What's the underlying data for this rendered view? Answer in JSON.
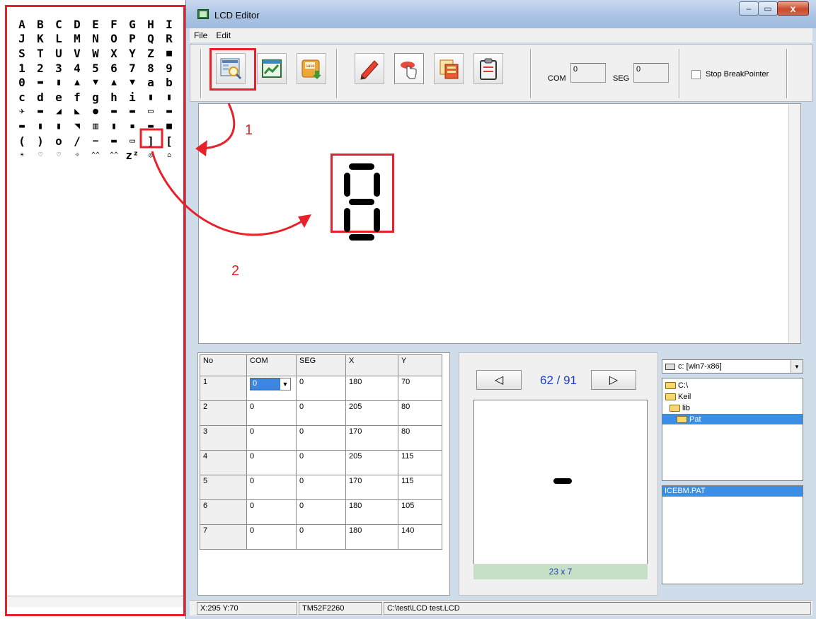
{
  "palette": {
    "glyphs": [
      "A",
      "B",
      "C",
      "D",
      "E",
      "F",
      "G",
      "H",
      "I",
      "J",
      "K",
      "L",
      "M",
      "N",
      "O",
      "P",
      "Q",
      "R",
      "S",
      "T",
      "U",
      "V",
      "W",
      "X",
      "Y",
      "Z",
      "■",
      "1",
      "2",
      "3",
      "4",
      "5",
      "6",
      "7",
      "8",
      "9",
      "0",
      "▬",
      "▮",
      "▲",
      "▼",
      "▲",
      "▼",
      "a",
      "b",
      "c",
      "d",
      "e",
      "f",
      "g",
      "h",
      "i",
      "▮",
      "▮",
      "✈",
      "▬",
      "◢",
      "◣",
      "●",
      "▬",
      "▬",
      "▭",
      "▬",
      "▬",
      "▮",
      "▮",
      "◥",
      "▥",
      "▮",
      "▪",
      "▬",
      "■",
      "(",
      ")",
      "o",
      "/",
      "—",
      "▬",
      "▭",
      "]",
      "[",
      "☀",
      "♡",
      "♡",
      "☼",
      "^^",
      "^^",
      "zᶻ",
      "◎",
      "⌂"
    ]
  },
  "window": {
    "title": "LCD Editor",
    "controls": {
      "minimize": "–",
      "maximize": "▭",
      "close": "x"
    }
  },
  "menu": {
    "file": "File",
    "edit": "Edit"
  },
  "toolbar": {
    "icons": [
      "load-icon",
      "chart-icon",
      "save-icon",
      "pencil-icon",
      "pointer-icon",
      "copy-icon",
      "clipboard-icon"
    ],
    "com_label": "COM",
    "com_value": "0",
    "seg_label": "SEG",
    "seg_value": "0",
    "stop_breakpointer_label": "Stop BreakPointer"
  },
  "annotations": {
    "step1": "1",
    "step2": "2"
  },
  "segment_table": {
    "headers": [
      "No",
      "COM",
      "SEG",
      "X",
      "Y"
    ],
    "rows": [
      [
        "1",
        "0",
        "0",
        "180",
        "70"
      ],
      [
        "2",
        "0",
        "0",
        "205",
        "80"
      ],
      [
        "3",
        "0",
        "0",
        "170",
        "80"
      ],
      [
        "4",
        "0",
        "0",
        "205",
        "115"
      ],
      [
        "5",
        "0",
        "0",
        "170",
        "115"
      ],
      [
        "6",
        "0",
        "0",
        "180",
        "105"
      ],
      [
        "7",
        "0",
        "0",
        "180",
        "140"
      ]
    ]
  },
  "preview": {
    "prev_symbol": "◁",
    "next_symbol": "▷",
    "page_counter": "62 / 91",
    "size_label": "23 x 7"
  },
  "files": {
    "drive": "c: [win7-x86]",
    "folders": [
      "C:\\",
      "Keil",
      "lib",
      "Pat"
    ],
    "selected_folder": "Pat",
    "file_list": [
      "ICEBM.PAT"
    ]
  },
  "status": {
    "coordinates": "X:295 Y:70",
    "chip": "TM52F2260",
    "path": "C:\\test\\LCD test.LCD"
  },
  "colors": {
    "annotation_red": "#e8202a",
    "selection_blue": "#3a8ee6",
    "counter_blue": "#1f3fc4",
    "size_bar_green": "#c6e0c8"
  }
}
